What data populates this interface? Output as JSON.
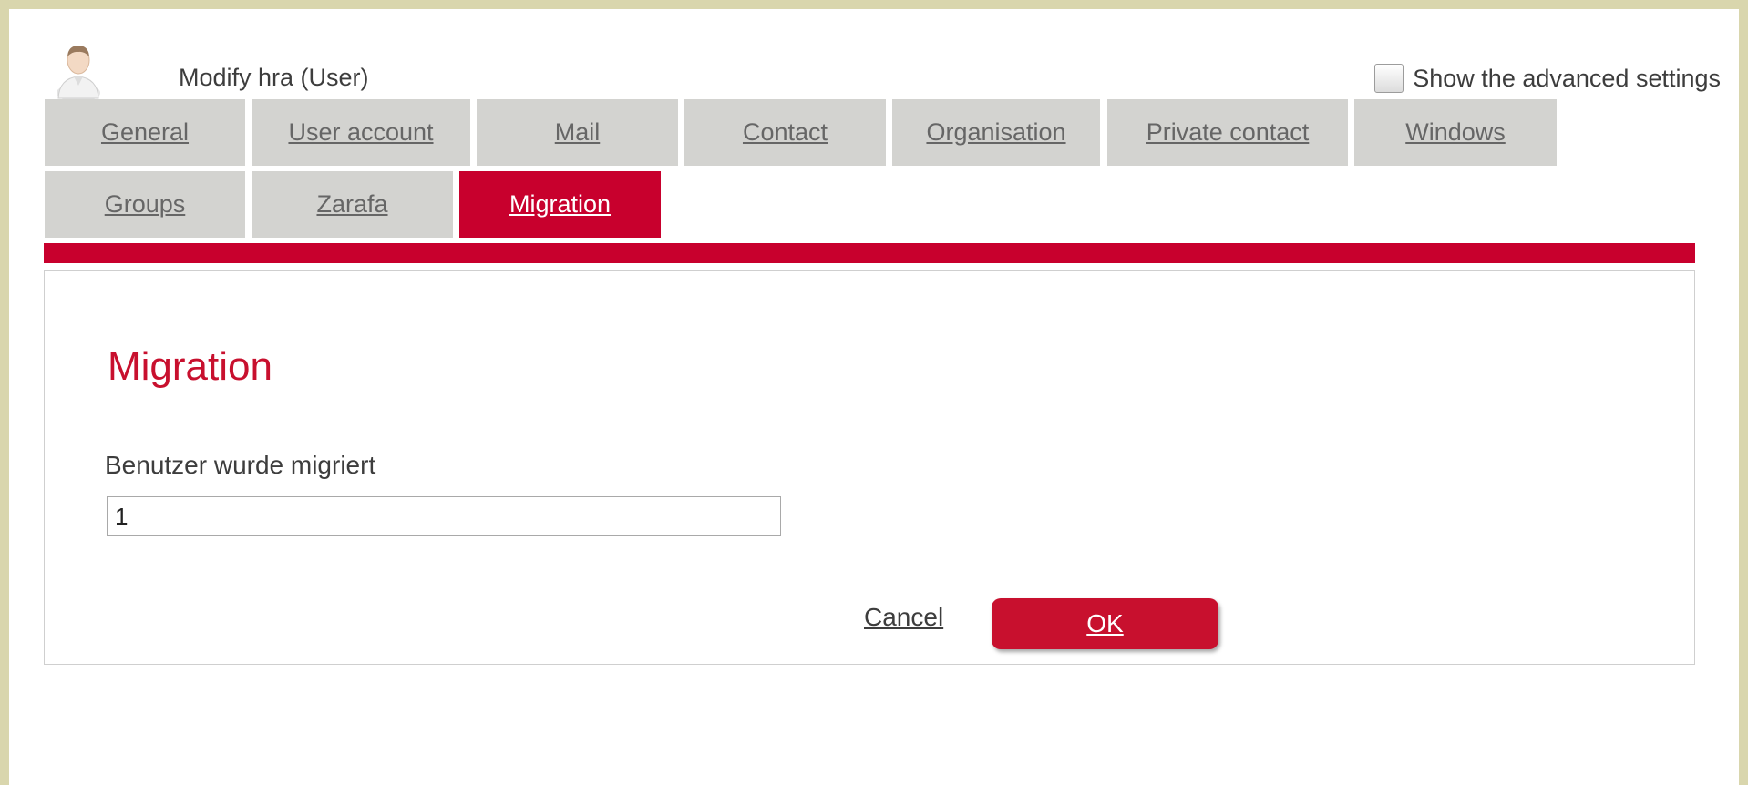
{
  "header": {
    "title": "Modify hra (User)",
    "avatar_icon": "user-avatar-icon",
    "advanced_label": "Show the advanced settings",
    "advanced_checked": false
  },
  "tabs": [
    {
      "label": "General",
      "active": false
    },
    {
      "label": "User account",
      "active": false
    },
    {
      "label": "Mail",
      "active": false
    },
    {
      "label": "Contact",
      "active": false
    },
    {
      "label": "Organisation",
      "active": false
    },
    {
      "label": "Private contact",
      "active": false
    },
    {
      "label": "Windows",
      "active": false
    },
    {
      "label": "Groups",
      "active": false
    },
    {
      "label": "Zarafa",
      "active": false
    },
    {
      "label": "Migration",
      "active": true
    }
  ],
  "section": {
    "heading": "Migration",
    "field_label": "Benutzer wurde migriert",
    "field_value": "1"
  },
  "actions": {
    "cancel_label": "Cancel",
    "ok_label": "OK"
  },
  "colors": {
    "accent": "#c8002d",
    "tab_inactive": "#d3d3d0",
    "outer_background": "#d9d6ad"
  }
}
